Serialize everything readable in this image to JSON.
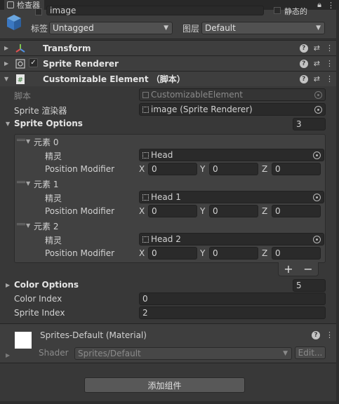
{
  "window": {
    "tab_label": "检查器",
    "tab_icons": [
      "lock-icon",
      "more-icon"
    ]
  },
  "header": {
    "name_value": "image",
    "static_label": "静态的",
    "tag_label": "标签",
    "tag_value": "Untagged",
    "layer_label": "图层",
    "layer_value": "Default"
  },
  "components": [
    {
      "name": "Transform"
    },
    {
      "name": "Sprite Renderer"
    },
    {
      "name": "Customizable Element （脚本）"
    }
  ],
  "script": {
    "script_label": "脚本",
    "script_value": "CustomizableElement",
    "sprite_renderer_label": "Sprite 渲染器",
    "sprite_renderer_value": "image (Sprite Renderer)",
    "sprite_options_label": "Sprite Options",
    "sprite_options_count": "3",
    "elements": [
      {
        "label": "元素 0",
        "sprite_label": "精灵",
        "sprite_value": "Head",
        "pm_label": "Position Modifier",
        "x": "0",
        "y": "0",
        "z": "0"
      },
      {
        "label": "元素 1",
        "sprite_label": "精灵",
        "sprite_value": "Head 1",
        "pm_label": "Position Modifier",
        "x": "0",
        "y": "0",
        "z": "0"
      },
      {
        "label": "元素 2",
        "sprite_label": "精灵",
        "sprite_value": "Head 2",
        "pm_label": "Position Modifier",
        "x": "0",
        "y": "0",
        "z": "0"
      }
    ],
    "axis_x": "X",
    "axis_y": "Y",
    "axis_z": "Z",
    "plus": "+",
    "minus": "−",
    "color_options_label": "Color Options",
    "color_options_count": "5",
    "color_index_label": "Color Index",
    "color_index_value": "0",
    "sprite_index_label": "Sprite Index",
    "sprite_index_value": "2"
  },
  "material": {
    "name": "Sprites-Default (Material)",
    "shader_label": "Shader",
    "shader_value": "Sprites/Default",
    "edit_label": "Edit..."
  },
  "add_component_label": "添加组件"
}
